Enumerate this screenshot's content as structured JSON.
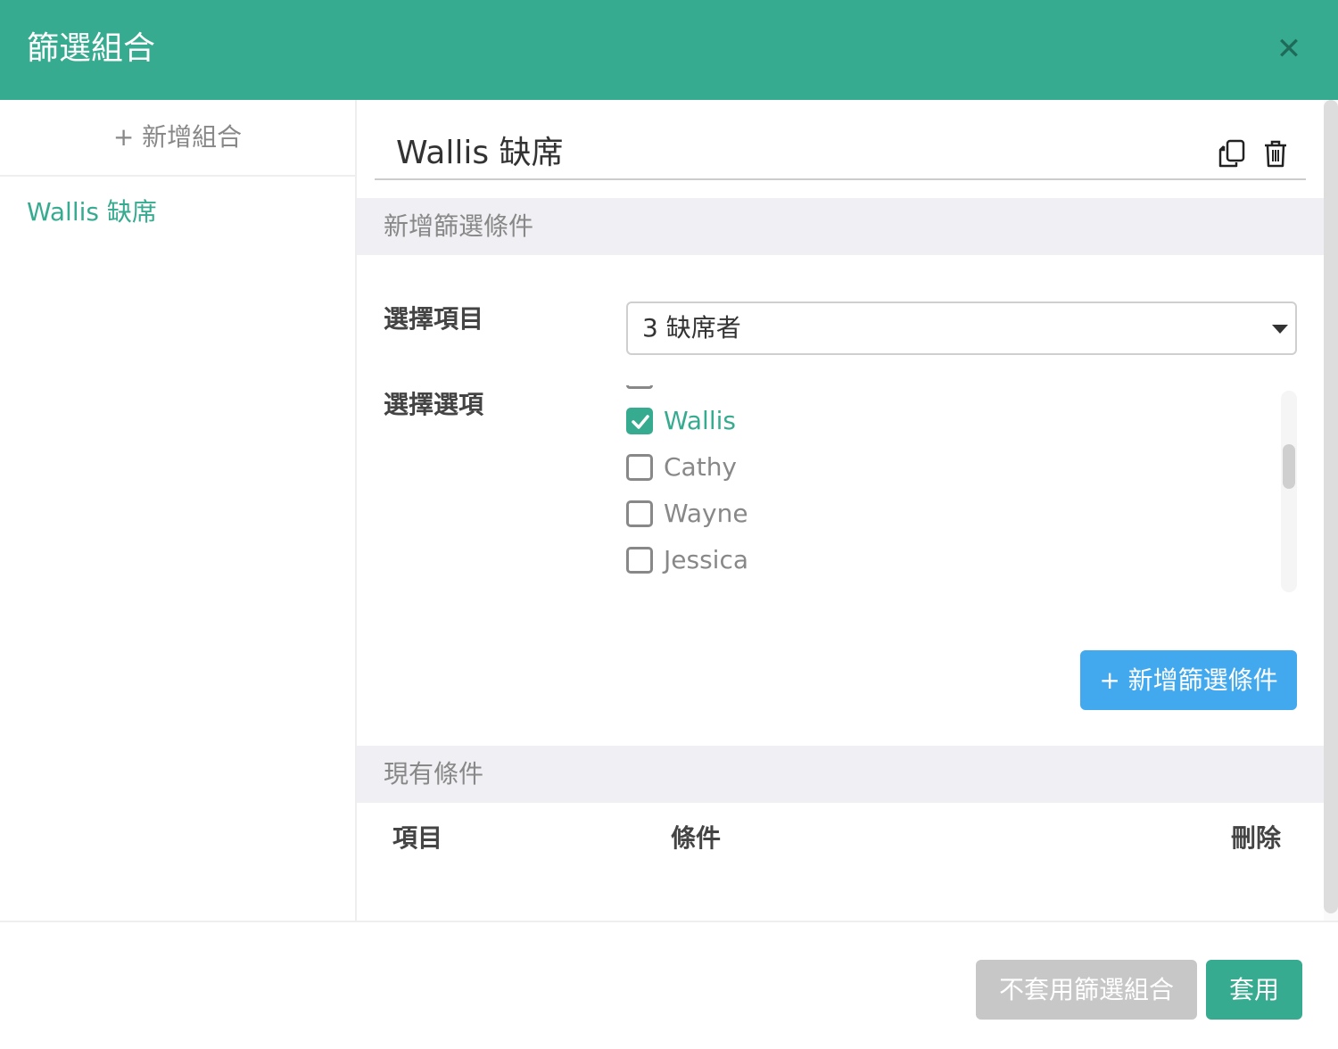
{
  "dialog": {
    "title": "篩選組合",
    "close_icon": "close-icon"
  },
  "sidebar": {
    "add_label": "+ 新增組合",
    "items": [
      {
        "label": "Wallis 缺席",
        "selected": true
      }
    ]
  },
  "editor": {
    "name": "Wallis 缺席",
    "icons": [
      "copy-icon",
      "trash-icon"
    ],
    "add_section_title": "新增篩選條件",
    "select_item_label": "選擇項目",
    "select_item_value": "3 缺席者",
    "select_options_label": "選擇選項",
    "options": [
      {
        "label": "Wallis",
        "checked": true
      },
      {
        "label": "Cathy",
        "checked": false
      },
      {
        "label": "Wayne",
        "checked": false
      },
      {
        "label": "Jessica",
        "checked": false
      }
    ],
    "add_condition_button": "+ 新增篩選條件",
    "existing_section_title": "現有條件",
    "table_headers": [
      "項目",
      "條件",
      "刪除"
    ]
  },
  "footer": {
    "cancel_button": "不套用篩選組合",
    "apply_button": "套用"
  },
  "colors": {
    "header": "#37ab90",
    "accent": "#37ab90",
    "primary_button": "#42a9ee",
    "disabled_button": "#c7c7c7"
  }
}
